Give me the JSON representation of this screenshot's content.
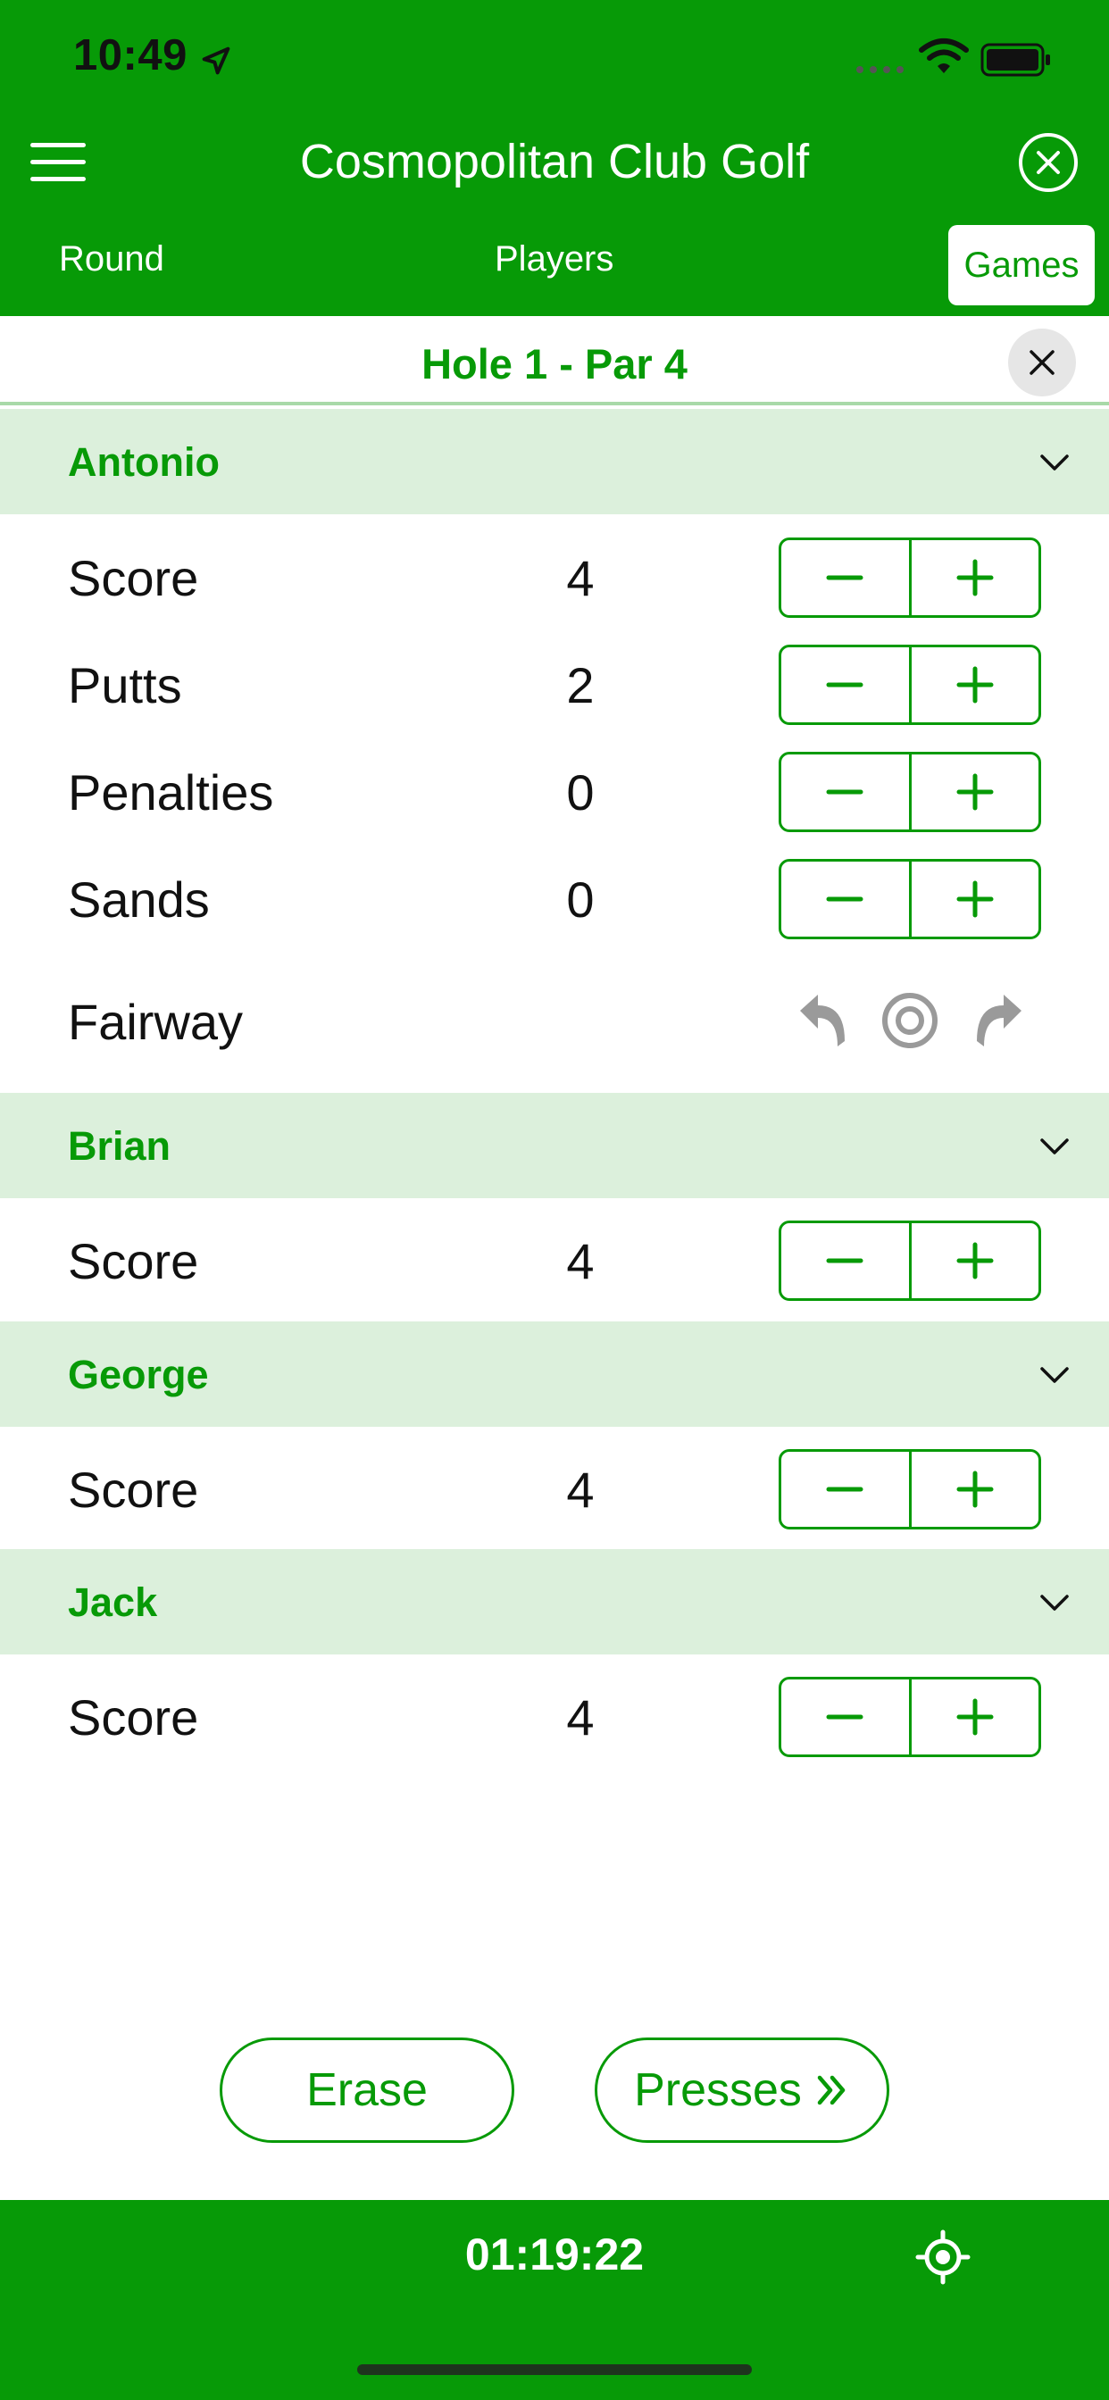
{
  "status_bar": {
    "time": "10:49"
  },
  "header": {
    "title": "Cosmopolitan Club Golf",
    "tabs": [
      {
        "label": "Round"
      },
      {
        "label": "Players"
      },
      {
        "label": "Games"
      }
    ],
    "active_tab": "Games"
  },
  "hole": {
    "title": "Hole 1  -  Par 4"
  },
  "players": [
    {
      "name": "Antonio",
      "rows": [
        {
          "label": "Score",
          "value": "4"
        },
        {
          "label": "Putts",
          "value": "2"
        },
        {
          "label": "Penalties",
          "value": "0"
        },
        {
          "label": "Sands",
          "value": "0"
        }
      ],
      "fairway_label": "Fairway",
      "fairway_options": [
        "miss-left-icon",
        "hit-target-icon",
        "miss-right-icon"
      ]
    },
    {
      "name": "Brian",
      "rows": [
        {
          "label": "Score",
          "value": "4"
        }
      ]
    },
    {
      "name": "George",
      "rows": [
        {
          "label": "Score",
          "value": "4"
        }
      ]
    },
    {
      "name": "Jack",
      "rows": [
        {
          "label": "Score",
          "value": "4"
        }
      ]
    }
  ],
  "actions": {
    "erase_label": "Erase",
    "presses_label": "Presses"
  },
  "footer": {
    "timer": "01:19:22"
  },
  "colors": {
    "brand_green": "#079a07",
    "section_bg": "#dcf0dc",
    "divider": "#a8d9a8"
  }
}
